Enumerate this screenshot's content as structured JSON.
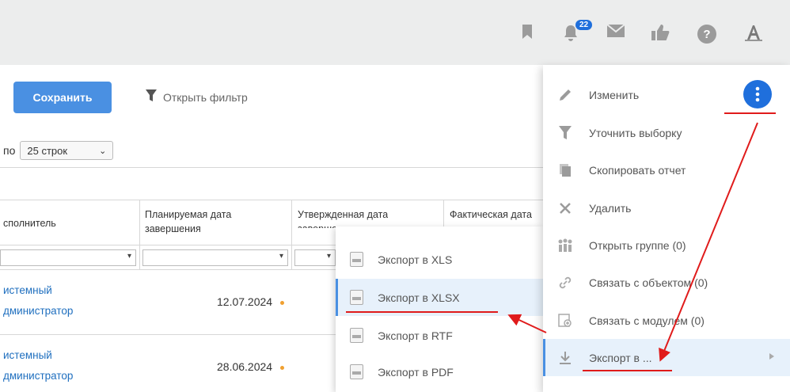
{
  "topbar": {
    "notification_count": "22",
    "icons": [
      "bookmark-icon",
      "bell-icon",
      "mail-icon",
      "thumbs-up-icon",
      "help-icon",
      "font-icon"
    ]
  },
  "toolbar": {
    "save_label": "Сохранить",
    "filter_label": "Открыть фильтр"
  },
  "pagination": {
    "prefix": "по",
    "selected": "25 строк"
  },
  "table": {
    "headers": {
      "executor": "сполнитель",
      "planned_line1": "Планируемая дата",
      "planned_line2": "завершения",
      "approved_line1": "Утвержденная дата",
      "approved_line2": "завершения",
      "actual_line1": "Фактическая дата",
      "actual_line2": "завершения"
    },
    "rows": [
      {
        "executor_line1": "истемный",
        "executor_line2": "дминистратор",
        "planned_date": "12.07.2024"
      },
      {
        "executor_line1": "истемный",
        "executor_line2": "дминистратор",
        "planned_date": "28.06.2024"
      }
    ]
  },
  "export_submenu": {
    "items": [
      "Экспорт в XLS",
      "Экспорт в XLSX",
      "Экспорт в RTF",
      "Экспорт в PDF"
    ],
    "active_index": 1
  },
  "actions_menu": {
    "items": [
      {
        "label": "Изменить",
        "icon": "pencil-icon"
      },
      {
        "label": "Уточнить выборку",
        "icon": "filter-icon"
      },
      {
        "label": "Скопировать отчет",
        "icon": "copy-icon"
      },
      {
        "label": "Удалить",
        "icon": "close-icon"
      },
      {
        "label": "Открыть группе (0)",
        "icon": "group-icon"
      },
      {
        "label": "Связать с объектом (0)",
        "icon": "link-icon"
      },
      {
        "label": "Связать с модулем (0)",
        "icon": "module-icon"
      },
      {
        "label": "Экспорт в ...",
        "icon": "download-icon"
      }
    ],
    "active_index": 7
  },
  "colors": {
    "accent": "#4a90e2",
    "brand_blue": "#1f6fdc",
    "annotation_red": "#e01b1b",
    "link": "#1f6fbf",
    "status_dot": "#f0a030"
  }
}
